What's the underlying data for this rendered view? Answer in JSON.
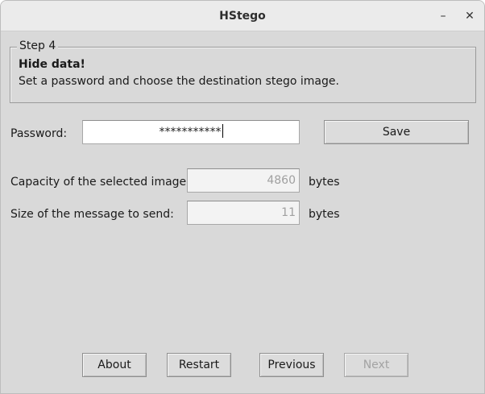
{
  "window": {
    "title": "HStego",
    "minimize_glyph": "–",
    "close_glyph": "✕"
  },
  "step": {
    "legend": "Step 4",
    "heading": "Hide data!",
    "description": "Set a password and choose the destination stego image."
  },
  "form": {
    "password_label": "Password:",
    "password_value": "***********",
    "save_label": "Save",
    "capacity_label": "Capacity of the selected image:",
    "capacity_value": "4860",
    "capacity_unit": "bytes",
    "message_size_label": "Size of the message to send:",
    "message_size_value": "11",
    "message_size_unit": "bytes"
  },
  "nav": {
    "about": "About",
    "restart": "Restart",
    "previous": "Previous",
    "next": "Next"
  },
  "colors": {
    "window_bg": "#d9d9d9",
    "titlebar_bg": "#ebebeb",
    "disabled_text": "#a3a3a3"
  }
}
